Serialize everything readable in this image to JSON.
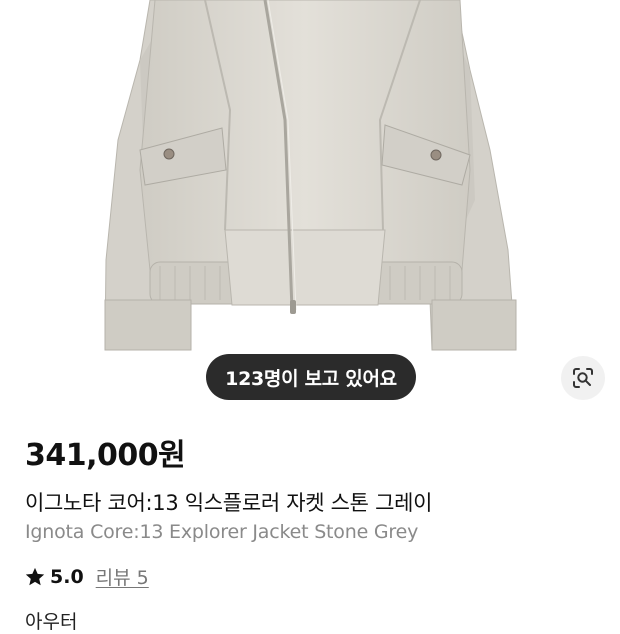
{
  "product": {
    "viewers_text": "123명이 보고 있어요",
    "price": "341,000원",
    "title_ko": "이그노타 코어:13 익스플로러 자켓 스톤 그레이",
    "title_en": "Ignota Core:13 Explorer Jacket Stone Grey",
    "rating": "5.0",
    "review_link": "리뷰 5",
    "next_section_partial": "아우터"
  },
  "icons": {
    "lens": "image-search-lens-icon",
    "star": "star-icon"
  },
  "colors": {
    "pill_bg": "#2b2b2b",
    "lens_bg": "#f1f1f1",
    "price": "#111111",
    "subtitle": "#8a8a8a",
    "jacket": "#d9d6cf"
  }
}
